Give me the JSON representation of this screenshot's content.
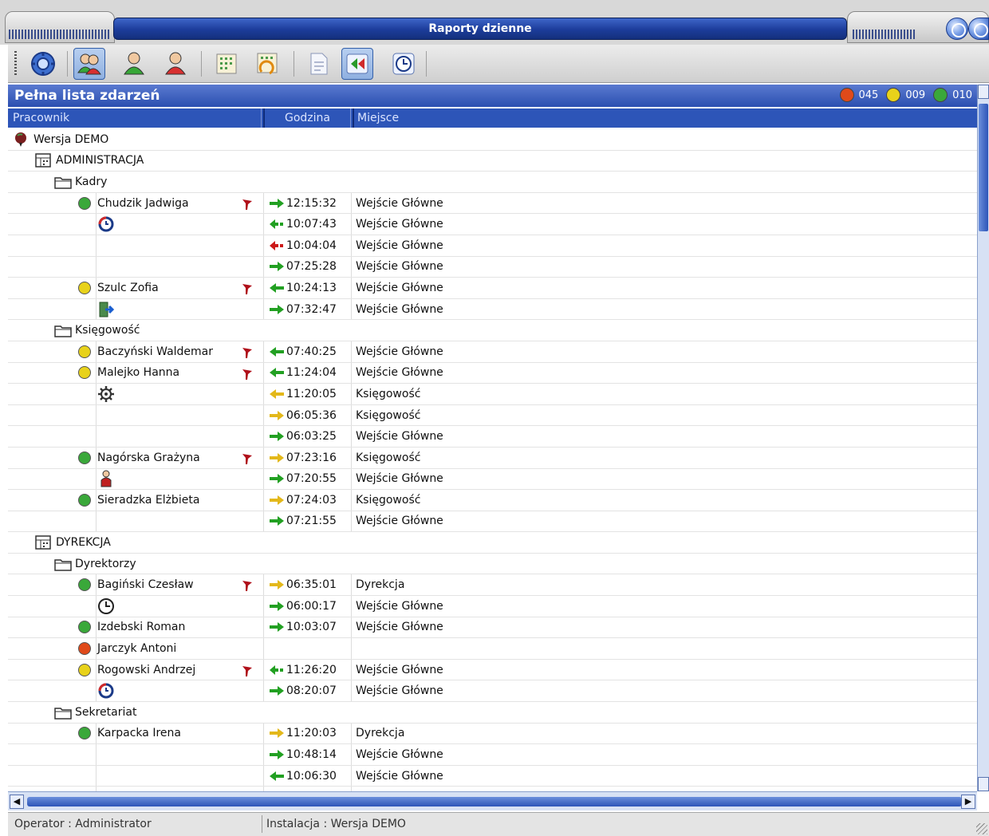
{
  "window": {
    "title": "Raporty dzienne"
  },
  "toolbar": {
    "buttons": [
      {
        "name": "settings-icon",
        "pressed": false
      },
      {
        "name": "users-icon",
        "pressed": true
      },
      {
        "name": "user-green-icon",
        "pressed": false
      },
      {
        "name": "user-red-icon",
        "pressed": false
      },
      {
        "name": "grid-icon",
        "pressed": false
      },
      {
        "name": "grid-refresh-icon",
        "pressed": false
      },
      {
        "name": "document-icon",
        "pressed": false
      },
      {
        "name": "back-icon",
        "pressed": true
      },
      {
        "name": "clock-icon",
        "pressed": false
      }
    ]
  },
  "panel": {
    "title": "Pełna lista zdarzeń",
    "counters": [
      {
        "color": "#e04a1a",
        "value": "045"
      },
      {
        "color": "#e8d21a",
        "value": "009"
      },
      {
        "color": "#3aa83a",
        "value": "010"
      }
    ]
  },
  "columns": {
    "employee": "Pracownik",
    "time": "Godzina",
    "place": "Miejsce"
  },
  "colors": {
    "green": "#3aa83a",
    "yellow": "#e8d21a",
    "red": "#e04a1a",
    "arrow_green": "#22a022",
    "arrow_yellow": "#e3b81a",
    "arrow_red": "#cc1a1a",
    "flag": "#b0101a"
  },
  "rows": [
    {
      "kind": "root",
      "label": "Wersja DEMO"
    },
    {
      "kind": "dept",
      "label": "ADMINISTRACJA"
    },
    {
      "kind": "group",
      "label": "Kadry"
    },
    {
      "kind": "entry",
      "employee": "Chudzik Jadwiga",
      "status": "green",
      "flag": true,
      "arrow": "in-green",
      "time": "12:15:32",
      "place": "Wejście Główne"
    },
    {
      "kind": "entry",
      "icon": "clock-refresh-icon",
      "arrow": "out-green-dot",
      "time": "10:07:43",
      "place": "Wejście Główne"
    },
    {
      "kind": "entry",
      "arrow": "out-red-dot",
      "time": "10:04:04",
      "place": "Wejście Główne"
    },
    {
      "kind": "entry",
      "arrow": "in-green",
      "time": "07:25:28",
      "place": "Wejście Główne"
    },
    {
      "kind": "entry",
      "employee": "Szulc Zofia",
      "status": "yellow",
      "flag": true,
      "arrow": "out-green",
      "time": "10:24:13",
      "place": "Wejście Główne"
    },
    {
      "kind": "entry",
      "icon": "exit-door-icon",
      "arrow": "in-green",
      "time": "07:32:47",
      "place": "Wejście Główne"
    },
    {
      "kind": "group",
      "label": "Księgowość"
    },
    {
      "kind": "entry",
      "employee": "Baczyński Waldemar",
      "status": "yellow",
      "flag": true,
      "arrow": "out-green",
      "time": "07:40:25",
      "place": "Wejście Główne"
    },
    {
      "kind": "entry",
      "employee": "Malejko Hanna",
      "status": "yellow",
      "flag": true,
      "arrow": "out-green",
      "time": "11:24:04",
      "place": "Wejście Główne"
    },
    {
      "kind": "entry",
      "icon": "gear-icon",
      "arrow": "out-yellow",
      "time": "11:20:05",
      "place": "Księgowość"
    },
    {
      "kind": "entry",
      "arrow": "in-yellow",
      "time": "06:05:36",
      "place": "Księgowość"
    },
    {
      "kind": "entry",
      "arrow": "in-green",
      "time": "06:03:25",
      "place": "Wejście Główne"
    },
    {
      "kind": "entry",
      "employee": "Nagórska Grażyna",
      "status": "green",
      "flag": true,
      "arrow": "in-yellow",
      "time": "07:23:16",
      "place": "Księgowość"
    },
    {
      "kind": "entry",
      "icon": "person-red-icon",
      "arrow": "in-green",
      "time": "07:20:55",
      "place": "Wejście Główne"
    },
    {
      "kind": "entry",
      "employee": "Sieradzka Elżbieta",
      "status": "green",
      "flag": false,
      "arrow": "in-yellow",
      "time": "07:24:03",
      "place": "Księgowość"
    },
    {
      "kind": "entry",
      "arrow": "in-green",
      "time": "07:21:55",
      "place": "Wejście Główne"
    },
    {
      "kind": "dept",
      "label": "DYREKCJA"
    },
    {
      "kind": "group",
      "label": "Dyrektorzy"
    },
    {
      "kind": "entry",
      "employee": "Bagiński Czesław",
      "status": "green",
      "flag": true,
      "arrow": "in-yellow",
      "time": "06:35:01",
      "place": "Dyrekcja"
    },
    {
      "kind": "entry",
      "icon": "clock-icon",
      "arrow": "in-green",
      "time": "06:00:17",
      "place": "Wejście Główne"
    },
    {
      "kind": "entry",
      "employee": "Izdebski Roman",
      "status": "green",
      "flag": false,
      "arrow": "in-green",
      "time": "10:03:07",
      "place": "Wejście Główne"
    },
    {
      "kind": "entry",
      "employee": "Jarczyk Antoni",
      "status": "red",
      "flag": false,
      "arrow": "",
      "time": "",
      "place": ""
    },
    {
      "kind": "entry",
      "employee": "Rogowski Andrzej",
      "status": "yellow",
      "flag": true,
      "arrow": "out-green-dot",
      "time": "11:26:20",
      "place": "Wejście Główne"
    },
    {
      "kind": "entry",
      "icon": "clock-refresh-icon",
      "arrow": "in-green",
      "time": "08:20:07",
      "place": "Wejście Główne"
    },
    {
      "kind": "group",
      "label": "Sekretariat"
    },
    {
      "kind": "entry",
      "employee": "Karpacka Irena",
      "status": "green",
      "flag": false,
      "arrow": "in-yellow",
      "time": "11:20:03",
      "place": "Dyrekcja"
    },
    {
      "kind": "entry",
      "arrow": "in-green",
      "time": "10:48:14",
      "place": "Wejście Główne"
    },
    {
      "kind": "entry",
      "arrow": "out-green",
      "time": "10:06:30",
      "place": "Wejście Główne"
    },
    {
      "kind": "entry",
      "arrow": "",
      "time": "",
      "place": ""
    }
  ],
  "statusbar": {
    "operator": "Operator : Administrator",
    "installation": "Instalacja : Wersja DEMO"
  }
}
